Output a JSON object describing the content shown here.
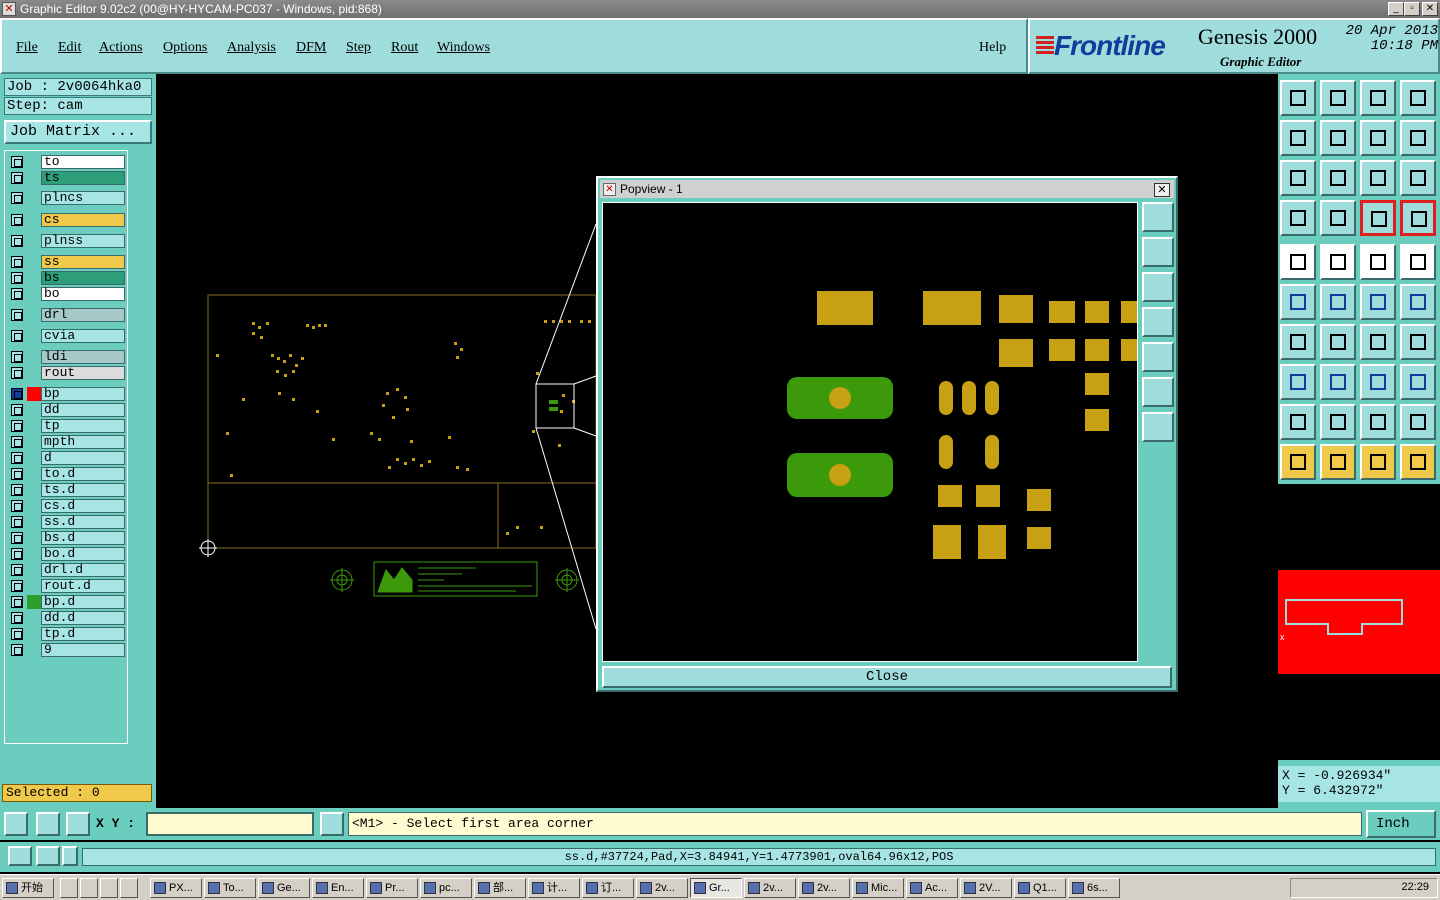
{
  "window": {
    "title": "Graphic Editor 9.02c2 (00@HY-HYCAM-PC037 - Windows, pid:868)"
  },
  "menu": [
    "File",
    "Edit",
    "Actions",
    "Options",
    "Analysis",
    "DFM",
    "Step",
    "Rout",
    "Windows"
  ],
  "help": "Help",
  "brand": {
    "logo": "Frontline",
    "product": "Genesis 2000",
    "subtitle": "Graphic Editor",
    "date": "20 Apr 2013",
    "time": "10:18 PM"
  },
  "job": {
    "job": "Job : 2v0064hka0",
    "step": "Step: cam",
    "matrix_button": "Job Matrix ..."
  },
  "layers": [
    {
      "name": "to",
      "color": "#ffffff",
      "mark": "✎",
      "active_color": ""
    },
    {
      "name": "ts",
      "color": "#2e9e7a",
      "mark": "✎",
      "active_color": ""
    },
    {
      "name": "plncs",
      "color": "#a7e5e5",
      "mark": "",
      "active_color": ""
    },
    {
      "name": "cs",
      "color": "#f0c84a",
      "mark": "✎",
      "active_color": ""
    },
    {
      "name": "plnss",
      "color": "#a7e5e5",
      "mark": "",
      "active_color": ""
    },
    {
      "name": "ss",
      "color": "#f0c84a",
      "mark": "✎",
      "active_color": ""
    },
    {
      "name": "bs",
      "color": "#2e9e7a",
      "mark": "✎",
      "active_color": ""
    },
    {
      "name": "bo",
      "color": "#ffffff",
      "mark": "✎",
      "active_color": ""
    },
    {
      "name": "drl",
      "color": "#a7c8c8",
      "mark": "",
      "active_color": ""
    },
    {
      "name": "cvia",
      "color": "#a7e5e5",
      "mark": "",
      "active_color": ""
    },
    {
      "name": "ldi",
      "color": "#a7c8c8",
      "mark": "",
      "active_color": ""
    },
    {
      "name": "rout",
      "color": "#dcdcdc",
      "mark": "",
      "active_color": ""
    },
    {
      "name": "bp",
      "color": "#a7e5e5",
      "mark": "✎⊞",
      "active_color": "#ff0000"
    },
    {
      "name": "dd",
      "color": "#a7e5e5",
      "mark": "",
      "active_color": ""
    },
    {
      "name": "tp",
      "color": "#a7e5e5",
      "mark": "✎",
      "active_color": ""
    },
    {
      "name": "mpth",
      "color": "#a7e5e5",
      "mark": "",
      "active_color": ""
    },
    {
      "name": "d",
      "color": "#a7e5e5",
      "mark": "",
      "active_color": ""
    },
    {
      "name": "to.d",
      "color": "#a7e5e5",
      "mark": "✎",
      "active_color": ""
    },
    {
      "name": "ts.d",
      "color": "#a7e5e5",
      "mark": "✎",
      "active_color": ""
    },
    {
      "name": "cs.d",
      "color": "#a7e5e5",
      "mark": "✎",
      "active_color": ""
    },
    {
      "name": "ss.d",
      "color": "#a7e5e5",
      "mark": "✎",
      "active_color": ""
    },
    {
      "name": "bs.d",
      "color": "#a7e5e5",
      "mark": "✎",
      "active_color": ""
    },
    {
      "name": "bo.d",
      "color": "#a7e5e5",
      "mark": "✎",
      "active_color": ""
    },
    {
      "name": "drl.d",
      "color": "#a7e5e5",
      "mark": "",
      "active_color": ""
    },
    {
      "name": "rout.d",
      "color": "#a7e5e5",
      "mark": "",
      "active_color": ""
    },
    {
      "name": "bp.d",
      "color": "#a7e5e5",
      "mark": "✎",
      "active_color": "#2e9e2e"
    },
    {
      "name": "dd.d",
      "color": "#a7e5e5",
      "mark": "",
      "active_color": ""
    },
    {
      "name": "tp.d",
      "color": "#a7e5e5",
      "mark": "✎",
      "active_color": ""
    },
    {
      "name": "9",
      "color": "#a7e5e5",
      "mark": "",
      "active_color": ""
    }
  ],
  "selected": "Selected : 0",
  "popview": {
    "title": "Popview - 1",
    "close_label": "Close"
  },
  "coords": {
    "x": "X = -0.926934\"",
    "y": "Y =  6.432972\""
  },
  "cmd": {
    "xy_label": "X Y :",
    "xy_value": "",
    "prompt": "<M1> - Select first area corner",
    "unit": "Inch"
  },
  "status": "ss.d,#37724,Pad,X=3.84941,Y=1.4773901,oval64.96x12,POS",
  "taskbar": {
    "start": "开始",
    "tasks": [
      "PX...",
      "To...",
      "Ge...",
      "En...",
      "Pr...",
      "pc...",
      "部...",
      "计...",
      "订...",
      "2v...",
      "Gr...",
      "2v...",
      "2v...",
      "Mic...",
      "Ac...",
      "2V...",
      "Q1...",
      "6s..."
    ],
    "clock": "22:29"
  },
  "colors": {
    "panel": "#6acdbd",
    "pad": "#c8a014",
    "green": "#3c9a0a",
    "accent": "#143c9c"
  }
}
